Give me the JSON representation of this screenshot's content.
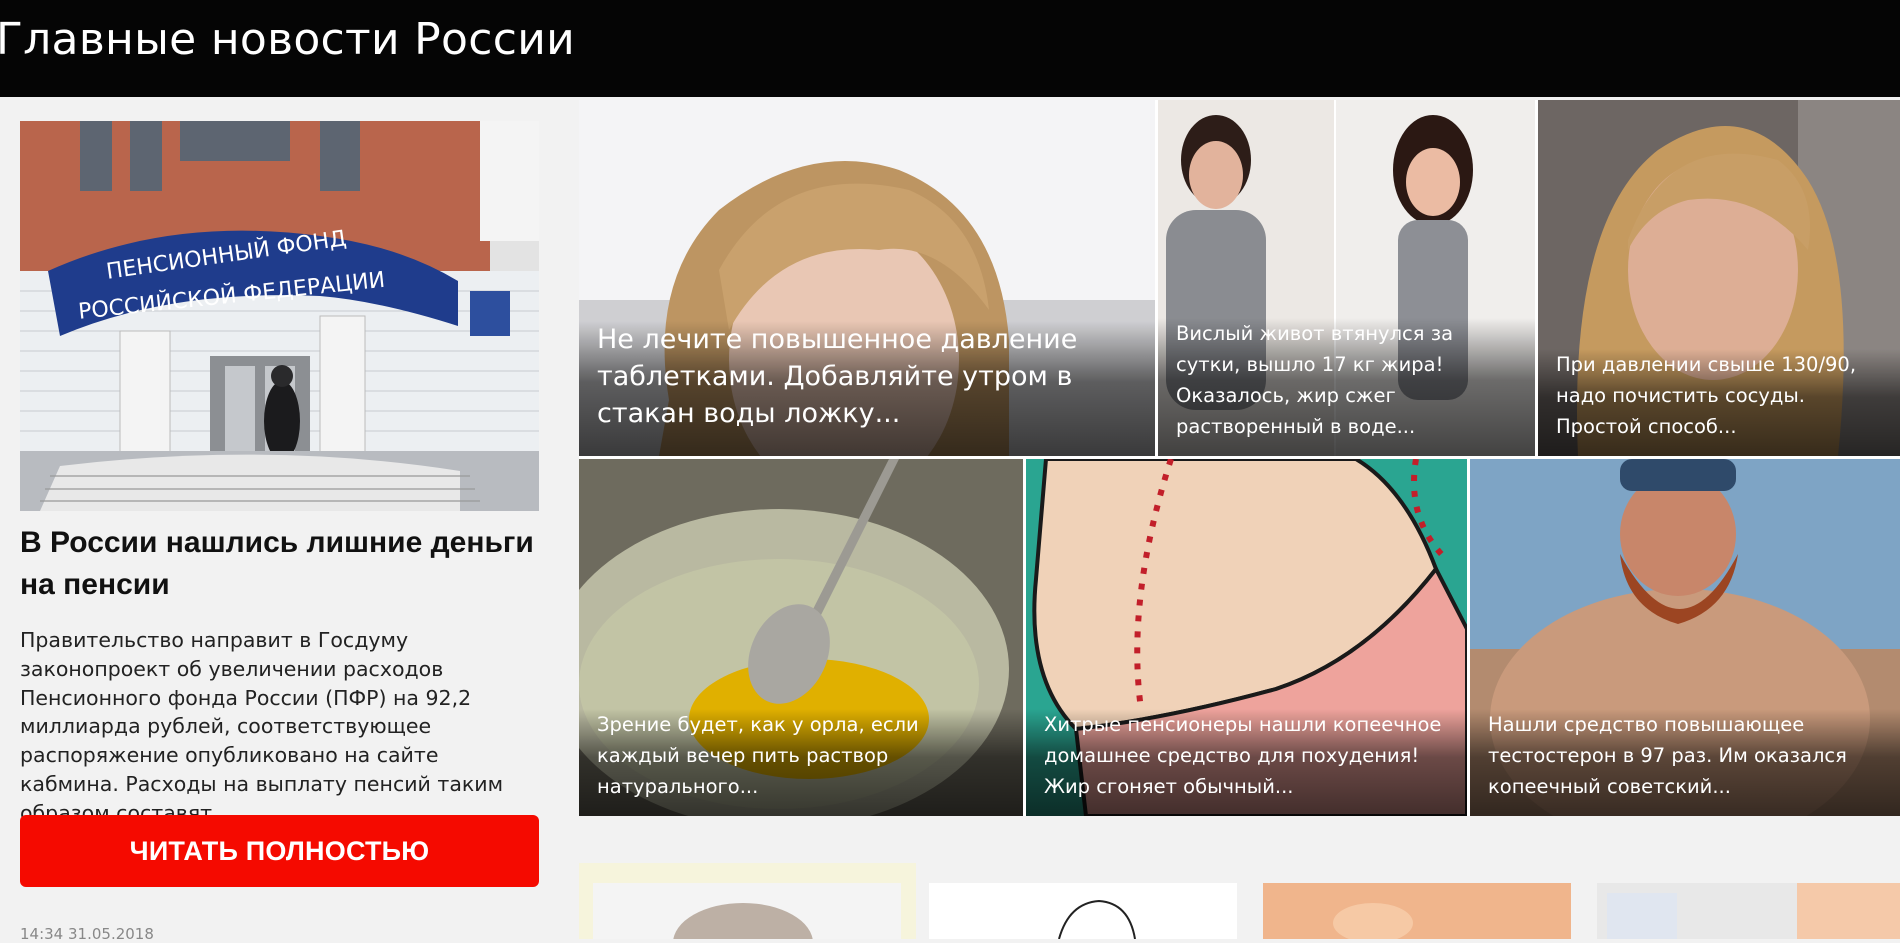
{
  "header": {
    "title": "Главные новости России"
  },
  "featured": {
    "image": {
      "alt": "Pension fund building",
      "sign_line1": "ПЕНСИОННЫЙ ФОНД",
      "sign_line2": "РОССИЙСКОЙ ФЕДЕРАЦИИ"
    },
    "headline": "В России нашлись лишние деньги на пенсии",
    "lede": "Правительство направит в Госдуму законопроект об увеличении расходов Пенсионного фонда России (ПФР) на 92,2 миллиарда рублей, соответствующее распоряжение опубликовано на сайте кабмина. Расходы на выплату пенсий таким образом составят...",
    "read_more_label": "ЧИТАТЬ ПОЛНОСТЬЮ",
    "timestamp": "14:34 31.05.2018"
  },
  "tiles": [
    {
      "caption": "Не лечите повышенное давление таблетками. Добавляйте утром в стакан воды ложку..."
    },
    {
      "caption": "Вислый живот втянулся за сутки, вышло 17 кг жира! Оказалось, жир сжег растворенный в воде..."
    },
    {
      "caption": "При давлении свыше 130/90, надо почистить сосуды. Простой способ..."
    },
    {
      "caption": "Зрение будет, как у орла, если каждый вечер пить раствор натурального..."
    },
    {
      "caption": "Хитрые пенсионеры нашли копеечное домашнее средство для похудения! Жир сгоняет обычный..."
    },
    {
      "caption": "Нашли средство повышающее тестостерон в 97 раз. Им оказался копеечный советский..."
    }
  ],
  "colors": {
    "accent": "#f50a00",
    "header_bg": "#050505",
    "page_bg": "#f2f2f2"
  }
}
